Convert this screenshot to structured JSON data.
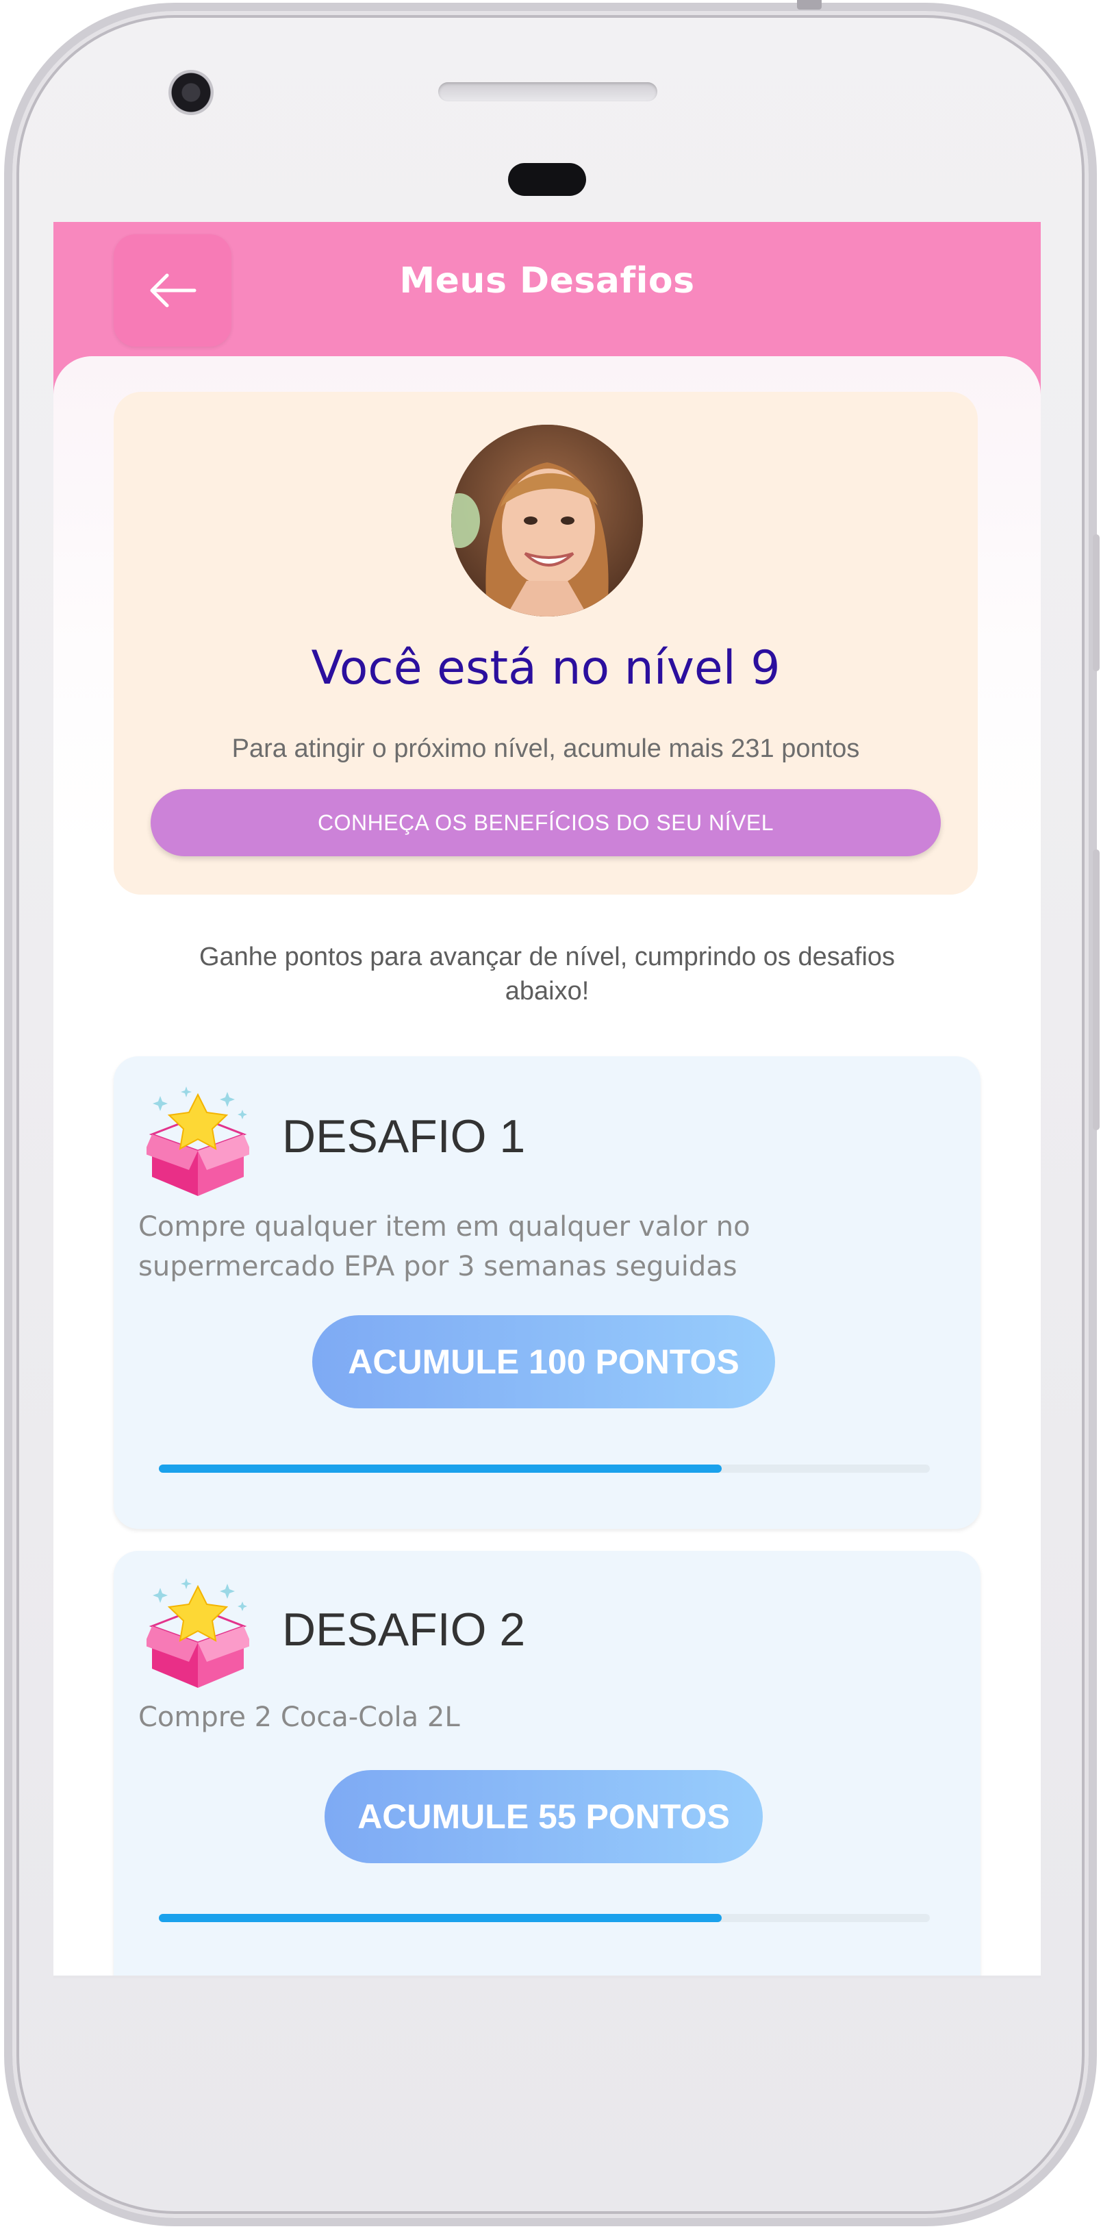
{
  "appbar": {
    "title": "Meus Desafios",
    "back_icon": "arrow-left-icon",
    "color": "#f888be"
  },
  "level": {
    "title": "Você está no nível 9",
    "subtitle": "Para atingir o próximo nível, acumule mais 231 pontos",
    "benefits_button": "CONHEÇA OS BENEFÍCIOS DO SEU NÍVEL"
  },
  "intro_text": "Ganhe pontos para avançar de nível, cumprindo os desafios abaixo!",
  "challenges": [
    {
      "title": "DESAFIO 1",
      "description": "Compre qualquer item em qualquer valor no supermercado EPA por 3 semanas seguidas",
      "button": "ACUMULE 100 PONTOS",
      "progress": 0.73,
      "icon": "gift-box-star-icon"
    },
    {
      "title": "DESAFIO 2",
      "description": "Compre 2 Coca-Cola 2L",
      "button": "ACUMULE 55 PONTOS",
      "progress": 0.73,
      "icon": "gift-box-star-icon"
    }
  ]
}
